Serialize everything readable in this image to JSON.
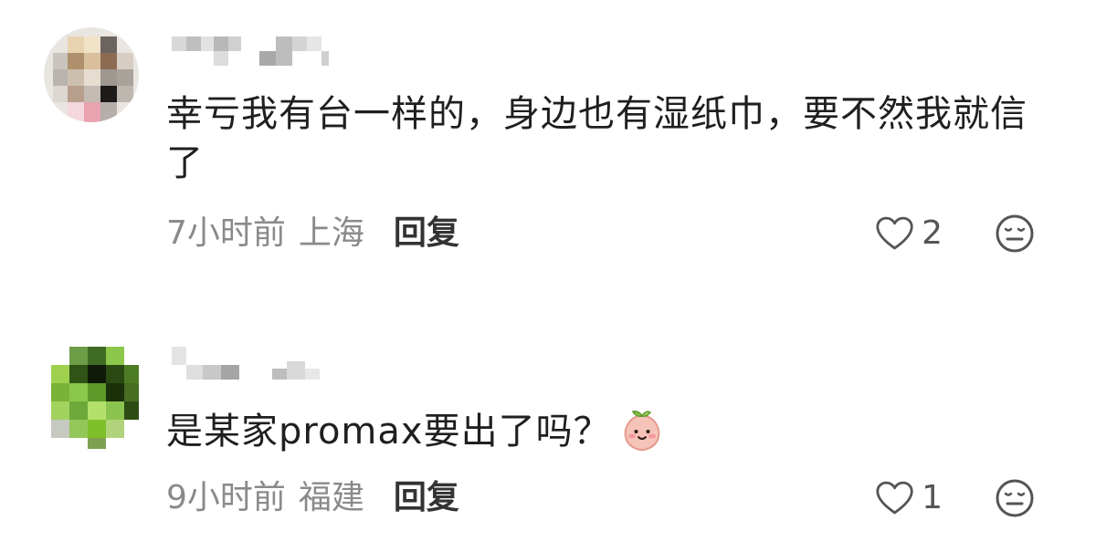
{
  "comments": [
    {
      "username": "",
      "text": "幸亏我有台一样的，身边也有湿纸巾，要不然我就信了",
      "time": "7小时前",
      "location": "上海",
      "reply_label": "回复",
      "likes": "2",
      "avatar_icon": "pixelated-avatar-icon",
      "emoji": null
    },
    {
      "username": "",
      "text": "是某家promax要出了吗？",
      "time": "9小时前",
      "location": "福建",
      "reply_label": "回复",
      "likes": "1",
      "avatar_icon": "pixelated-green-avatar-icon",
      "emoji": "peach-face-emoji"
    }
  ],
  "colors": {
    "text": "#1f1f1f",
    "meta": "#8a8a8a",
    "reply": "#333333",
    "icon": "#555555",
    "accent_green": "#7fbf2a"
  }
}
